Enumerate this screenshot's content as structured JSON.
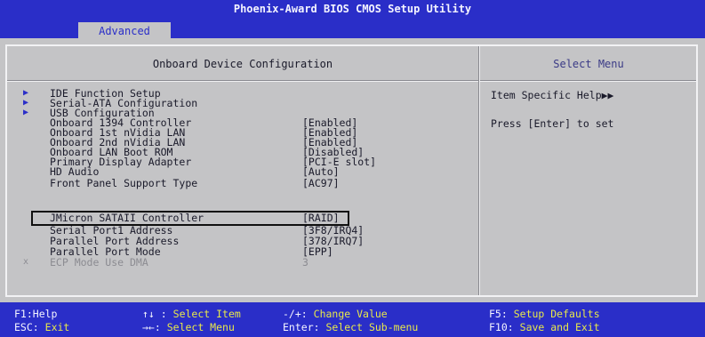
{
  "title": "Phoenix-Award BIOS CMOS Setup Utility",
  "menu": {
    "active_tab": "Advanced"
  },
  "main": {
    "heading": "Onboard Device Configuration",
    "items": [
      {
        "label": "IDE Function Setup",
        "value": "",
        "submenu": true,
        "enabled": true
      },
      {
        "label": "Serial-ATA Configuration",
        "value": "",
        "submenu": true,
        "enabled": true
      },
      {
        "label": "USB Configuration",
        "value": "",
        "submenu": true,
        "enabled": true
      },
      {
        "label": "Onboard 1394 Controller",
        "value": "[Enabled]",
        "submenu": false,
        "enabled": true
      },
      {
        "label": "Onboard 1st nVidia LAN",
        "value": "[Enabled]",
        "submenu": false,
        "enabled": true
      },
      {
        "label": "Onboard 2nd nVidia LAN",
        "value": "[Enabled]",
        "submenu": false,
        "enabled": true
      },
      {
        "label": "Onboard LAN Boot ROM",
        "value": "[Disabled]",
        "submenu": false,
        "enabled": true
      },
      {
        "label": "Primary Display Adapter",
        "value": "[PCI-E slot]",
        "submenu": false,
        "enabled": true
      },
      {
        "label": "HD Audio",
        "value": "[Auto]",
        "submenu": false,
        "enabled": true
      },
      {
        "label": "Front Panel Support Type",
        "value": "[AC97]",
        "submenu": false,
        "enabled": true
      },
      {
        "label": "JMicron SATAII Controller",
        "value": "[RAID]",
        "submenu": false,
        "enabled": true,
        "highlighted": true
      },
      {
        "label": "Serial Port1 Address",
        "value": "[3F8/IRQ4]",
        "submenu": false,
        "enabled": true
      },
      {
        "label": "Parallel Port Address",
        "value": "[378/IRQ7]",
        "submenu": false,
        "enabled": true
      },
      {
        "label": "Parallel Port Mode",
        "value": "[EPP]",
        "submenu": false,
        "enabled": true
      },
      {
        "label": "ECP Mode Use DMA",
        "value": "3",
        "submenu": false,
        "enabled": false,
        "marker": "x"
      }
    ]
  },
  "side": {
    "heading": "Select Menu",
    "help_title": "Item Specific Help",
    "help_arrow": "▶▶",
    "help_text": "Press [Enter] to set"
  },
  "footer": {
    "keys": [
      {
        "key": "F1:Help",
        "action": ""
      },
      {
        "key": "↑↓ :",
        "action": "Select Item"
      },
      {
        "key": "-/+:",
        "action": "Change Value"
      },
      {
        "key": "F5:",
        "action": "Setup Defaults"
      },
      {
        "key": "ESC:",
        "action": "Exit"
      },
      {
        "key": "→←:",
        "action": "Select Menu"
      },
      {
        "key": "Enter:",
        "action": "Select Sub-menu"
      },
      {
        "key": "F10:",
        "action": "Save and Exit"
      }
    ]
  },
  "colors": {
    "accent": "#2a2ec8",
    "background": "#c4c4c6",
    "footer_action": "#e8e84a"
  }
}
